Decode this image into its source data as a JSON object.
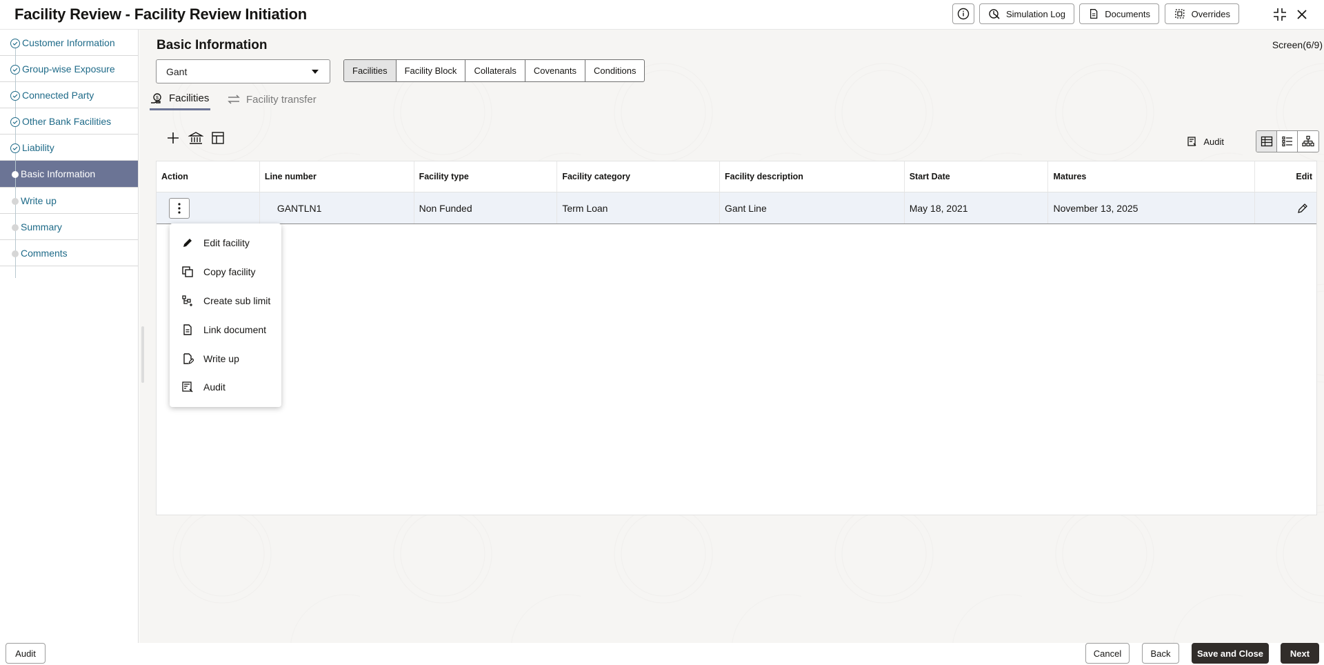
{
  "header": {
    "title": "Facility Review - Facility Review Initiation",
    "buttons": {
      "simulation_log": "Simulation Log",
      "documents": "Documents",
      "overrides": "Overrides"
    }
  },
  "sidebar": {
    "items": [
      {
        "label": "Customer Information",
        "state": "done"
      },
      {
        "label": "Group-wise Exposure",
        "state": "done"
      },
      {
        "label": "Connected Party",
        "state": "done"
      },
      {
        "label": "Other Bank Facilities",
        "state": "done"
      },
      {
        "label": "Liability",
        "state": "done"
      },
      {
        "label": "Basic Information",
        "state": "active"
      },
      {
        "label": "Write up",
        "state": "pending"
      },
      {
        "label": "Summary",
        "state": "pending"
      },
      {
        "label": "Comments",
        "state": "pending"
      }
    ]
  },
  "main": {
    "title": "Basic Information",
    "screen_counter": "Screen(6/9)",
    "customer_select": "Gant",
    "segments": [
      "Facilities",
      "Facility Block",
      "Collaterals",
      "Covenants",
      "Conditions"
    ],
    "tabs": {
      "facilities": "Facilities",
      "facility_transfer": "Facility transfer"
    },
    "audit_label": "Audit"
  },
  "table": {
    "columns": [
      "Action",
      "Line number",
      "Facility type",
      "Facility category",
      "Facility description",
      "Start Date",
      "Matures",
      "Edit"
    ],
    "row": {
      "line_number": "GANTLN1",
      "facility_type": "Non Funded",
      "facility_category": "Term Loan",
      "facility_description": "Gant Line",
      "start_date": "May 18, 2021",
      "matures": "November 13, 2025"
    }
  },
  "action_menu": {
    "items": [
      "Edit facility",
      "Copy facility",
      "Create sub limit",
      "Link document",
      "Write up",
      "Audit"
    ]
  },
  "footer": {
    "audit": "Audit",
    "cancel": "Cancel",
    "back": "Back",
    "save_and_close": "Save and Close",
    "next": "Next"
  },
  "colors": {
    "accent": "#6b7495",
    "link": "#1e6a88",
    "primary_button": "#312d2a"
  }
}
